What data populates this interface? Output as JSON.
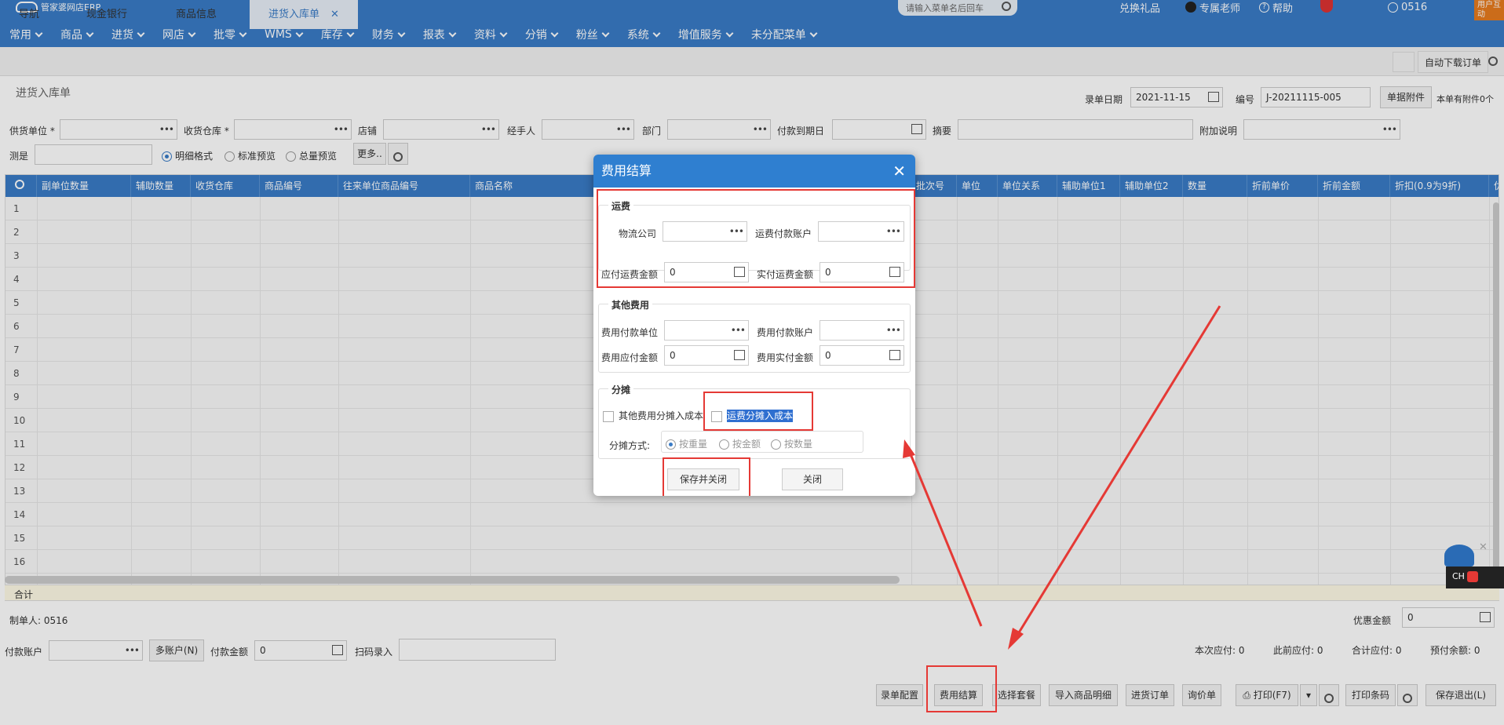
{
  "app": {
    "name": "管家婆网店ERP"
  },
  "top": {
    "search_placeholder": "请输入菜单名后回车",
    "gift": "兑换礼品",
    "teacher": "专属老师",
    "help": "帮助",
    "user": "0516",
    "corner": "用户互动"
  },
  "menu": [
    "常用",
    "商品",
    "进货",
    "网店",
    "批零",
    "WMS",
    "库存",
    "财务",
    "报表",
    "资料",
    "分销",
    "粉丝",
    "系统",
    "增值服务",
    "未分配菜单"
  ],
  "tabs": [
    "导航",
    "现金银行",
    "商品信息",
    "进货入库单"
  ],
  "toolbar": {
    "auto_download": "自动下载订单"
  },
  "page": {
    "title": "进货入库单"
  },
  "header": {
    "date_label": "录单日期",
    "date": "2021-11-15",
    "no_label": "编号",
    "no": "J-20211115-005",
    "attach_btn": "单据附件",
    "attach_info": "本单有附件0个"
  },
  "form": {
    "supplier": "供货单位",
    "warehouse": "收货仓库",
    "shop": "店铺",
    "handler": "经手人",
    "dept": "部门",
    "due": "付款到期日",
    "summary": "摘要",
    "note": "附加说明",
    "test": "测是",
    "r1": "明细格式",
    "r2": "标准预览",
    "r3": "总量预览",
    "more": "更多.."
  },
  "grid": {
    "columns": [
      "副单位数量",
      "辅助数量",
      "收货仓库",
      "商品编号",
      "往来单位商品编号",
      "商品名称",
      "批次号",
      "单位",
      "单位关系",
      "辅助单位1",
      "辅助单位2",
      "数量",
      "折前单价",
      "折前金额",
      "折扣(0.9为9折)",
      "优"
    ],
    "rows": [
      "1",
      "2",
      "3",
      "4",
      "5",
      "6",
      "7",
      "8",
      "9",
      "10",
      "11",
      "12",
      "13",
      "14",
      "15",
      "16"
    ],
    "total": "合计"
  },
  "footer": {
    "maker_label": "制单人:",
    "maker": "0516",
    "discount_label": "优惠金额",
    "discount": "0",
    "pay_acct": "付款账户",
    "multi": "多账户(N)",
    "pay_amt": "付款金额",
    "pay_amt_val": "0",
    "scan": "扫码录入",
    "this_due": "本次应付:",
    "this_due_v": "0",
    "prev_due": "此前应付:",
    "prev_due_v": "0",
    "total_due": "合计应付:",
    "total_due_v": "0",
    "prepay": "预付余额:",
    "prepay_v": "0"
  },
  "actions": {
    "config": "录单配置",
    "fee": "费用结算",
    "combo": "选择套餐",
    "import": "导入商品明细",
    "order": "进货订单",
    "inquiry": "询价单",
    "print": "打印(F7)",
    "barcode": "打印条码",
    "save_exit": "保存退出(L)"
  },
  "dialog": {
    "title": "费用结算",
    "freight": {
      "legend": "运费",
      "logistics": "物流公司",
      "acct": "运费付款账户",
      "payable": "应付运费金额",
      "payable_v": "0",
      "actual": "实付运费金额",
      "actual_v": "0"
    },
    "other": {
      "legend": "其他费用",
      "unit": "费用付款单位",
      "acct": "费用付款账户",
      "payable": "费用应付金额",
      "payable_v": "0",
      "actual": "费用实付金额",
      "actual_v": "0"
    },
    "alloc": {
      "legend": "分摊",
      "other_cost": "其他费用分摊入成本",
      "freight_cost": "运费分摊入成本",
      "method": "分摊方式:",
      "m1": "按重量",
      "m2": "按金额",
      "m3": "按数量"
    },
    "save_close": "保存并关闭",
    "close": "关闭"
  },
  "ime": {
    "text": "CH"
  }
}
